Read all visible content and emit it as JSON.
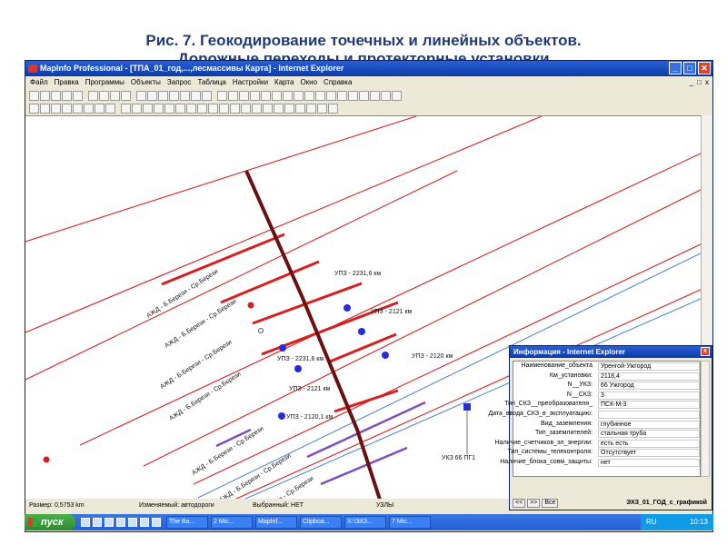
{
  "slide": {
    "title_line1": "Рис. 7. Геокодирование точечных и линейных объектов.",
    "title_line2": "Дорожные переходы и протекторные установки"
  },
  "window": {
    "title": "MapInfo Professional - [ТПА_01_год,...,лесмассивы Карта] - Internet Explorer",
    "minimize": "_",
    "maximize": "□",
    "close": "✕"
  },
  "menu": {
    "items": [
      "Файл",
      "Правка",
      "Программы",
      "Объекты",
      "Запрос",
      "Таблица",
      "Настройки",
      "Карта",
      "Окно",
      "Справка"
    ],
    "mdi": [
      "_",
      "□",
      "x"
    ]
  },
  "map": {
    "road_labels": [
      "АЖД - Б.Берези - Ср.Берези",
      "АЖД - Б.Берези - Ср.Берези",
      "АЖД - Б.Берези - Ср.Берези",
      "АЖД - Б.Берези - Ср.Берези",
      "АЖД - Б.Берези - Ср.Берези",
      "АЖД - Б.Берези - Ср.Берези",
      "АЖД - Б.Берези - Ср.Берези"
    ],
    "point_labels": [
      "УПЗ - 2231,6 км",
      "УПЗ - 2121 км",
      "УПЗ - 2231,6 км",
      "УПЗ - 2120 км",
      "УПЗ - 2121 км",
      "УПЗ - 2120,1 км",
      "УКЗ  66 ПГ1"
    ],
    "colors": {
      "pipeline": "#d42020",
      "road": "#6a1010",
      "cathodic": "#2a2ad8",
      "blue_line": "#4a7fd0"
    }
  },
  "status": {
    "scale": "Размер: 0,5753 km",
    "editable": "Изменяемый: автодороги",
    "selected": "Выбранный: НЕТ",
    "extra": "УЗЛЫ"
  },
  "info": {
    "title": "Информация - Internet Explorer",
    "close": "x",
    "rows": [
      {
        "k": "Наименование_объекта",
        "v": "Уренгой-Ужгород"
      },
      {
        "k": "Км_установки:",
        "v": "2118,4"
      },
      {
        "k": "N__УКЗ:",
        "v": "66 Ужгород"
      },
      {
        "k": "N__СКЗ:",
        "v": "3"
      },
      {
        "k": "Тип_СКЗ__преобразователя_",
        "v": "ПСК-М-3"
      },
      {
        "k": "Дата_ввода_СКЗ_в_эксплуатацию:",
        "v": ""
      },
      {
        "k": "Вид_заземления:",
        "v": "глубинное"
      },
      {
        "k": "Тип_заземлителей:",
        "v": "стальная труба"
      },
      {
        "k": "Наличие_счетчиков_эл_энергии:",
        "v": "есть есть"
      },
      {
        "k": "Тип_системы_телеконтроля:",
        "v": "Отсутствует"
      },
      {
        "k": "Наличие_блока_совм_защиты:",
        "v": "нет"
      }
    ],
    "nav": [
      "<<",
      ">>",
      "Все"
    ],
    "table": "ЭХЗ_01_ГОД_с_графикой"
  },
  "taskbar": {
    "start": "пуск",
    "tasks": [
      "The Ba...",
      "2 Mic...",
      "MapInf...",
      "Clipboa...",
      "X:\\ЭХЗ...",
      "7 Mic..."
    ],
    "lang": "RU",
    "clock": "10:13"
  }
}
